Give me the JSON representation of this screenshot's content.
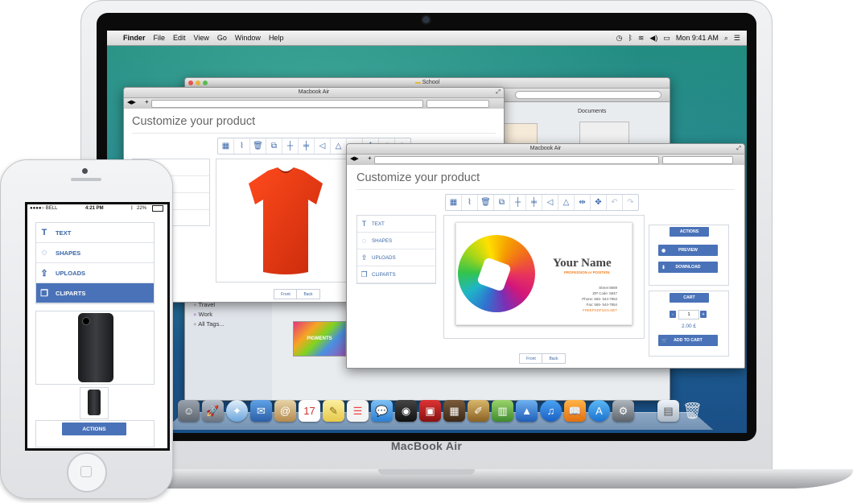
{
  "device_label": "MacBook Air",
  "menubar": {
    "apple_glyph": "",
    "items": [
      "Finder",
      "File",
      "Edit",
      "View",
      "Go",
      "Window",
      "Help"
    ],
    "clock": "Mon 9:41 AM"
  },
  "finder_window": {
    "title": "School",
    "documents_label": "Documents",
    "tags": [
      "Travel",
      "Work",
      "All Tags..."
    ],
    "thumbnail_caption": "PIGMENTS"
  },
  "back_window": {
    "title": "Macbook Air",
    "page_title": "Customize your product",
    "front_label": "Front",
    "back_label": "Back"
  },
  "front_window": {
    "title": "Macbook Air",
    "page_title": "Customize your product",
    "menu": [
      {
        "icon": "text-icon",
        "glyph": "T",
        "label": "TEXT"
      },
      {
        "icon": "shapes-icon",
        "glyph": "◌",
        "label": "SHAPES"
      },
      {
        "icon": "uploads-icon",
        "glyph": "⇪",
        "label": "UPLOADS"
      },
      {
        "icon": "cliparts-icon",
        "glyph": "❐",
        "label": "CLIPARTS"
      }
    ],
    "tools": [
      {
        "name": "grid-icon",
        "glyph": "▦"
      },
      {
        "name": "brush-icon",
        "glyph": "⌇"
      },
      {
        "name": "trash-icon",
        "glyph": "🗑"
      },
      {
        "name": "duplicate-icon",
        "glyph": "⧉"
      },
      {
        "name": "center-horizontal-icon",
        "glyph": "┼"
      },
      {
        "name": "center-vertical-icon",
        "glyph": "╪"
      },
      {
        "name": "flip-horizontal-icon",
        "glyph": "◁"
      },
      {
        "name": "flip-vertical-icon",
        "glyph": "△"
      },
      {
        "name": "align-icon",
        "glyph": "⇹"
      },
      {
        "name": "distribute-icon",
        "glyph": "✥"
      },
      {
        "name": "undo-icon",
        "glyph": "↶"
      },
      {
        "name": "redo-icon",
        "glyph": "↷"
      }
    ],
    "card": {
      "name": "Your Name",
      "subtitle": "PROFESSION or POSITION",
      "street": "Street 8569",
      "zip": "ZIP Code: 5847",
      "phone": "Phone: 565- 544-7853",
      "fax": "Fax: 565- 544-7854",
      "site": "FREEPSDFILES.NET"
    },
    "front_label": "Front",
    "back_label": "Back",
    "actions": {
      "title": "ACTIONS",
      "preview_label": "PREVIEW",
      "download_label": "DOWNLOAD"
    },
    "cart": {
      "title": "CART",
      "minus": "-",
      "plus": "+",
      "quantity": "1",
      "price": "2.00 £",
      "add_to_cart_label": "ADD TO CART"
    }
  },
  "iphone": {
    "carrier": "●●●●○ BELL",
    "time": "4:21 PM",
    "battery": "22%",
    "menu": [
      {
        "icon": "text-icon",
        "glyph": "T",
        "label": "TEXT"
      },
      {
        "icon": "shapes-icon",
        "glyph": "◌",
        "label": "SHAPES"
      },
      {
        "icon": "uploads-icon",
        "glyph": "⇪",
        "label": "UPLOADS"
      },
      {
        "icon": "cliparts-icon",
        "glyph": "❐",
        "label": "CLIPARTS"
      }
    ],
    "actions_label": "ACTIONS"
  },
  "colors": {
    "accent": "#4a72b8",
    "link": "#3a66a8",
    "card_orange": "#f07d1e"
  }
}
